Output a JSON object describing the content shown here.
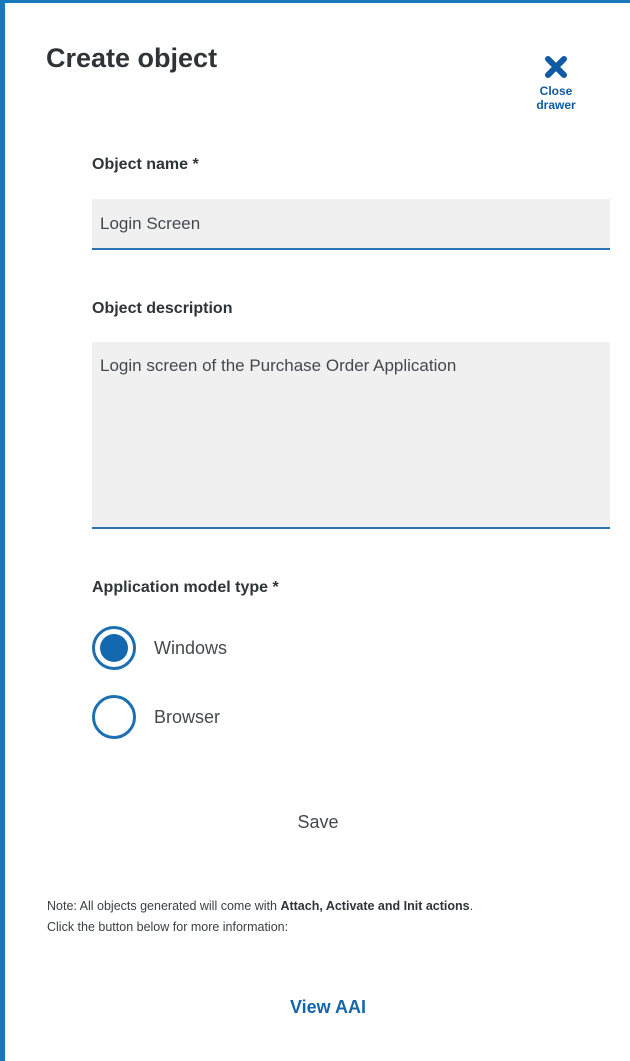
{
  "drawer": {
    "title": "Create object",
    "close_label_line1": "Close",
    "close_label_line2": "drawer"
  },
  "form": {
    "object_name_label": "Object name *",
    "object_name_value": "Login Screen",
    "object_description_label": "Object description",
    "object_description_value": "Login screen of the Purchase Order Application",
    "model_type_label": "Application model type *",
    "model_type_options": [
      {
        "label": "Windows",
        "selected": true
      },
      {
        "label": "Browser",
        "selected": false
      }
    ],
    "save_label": "Save"
  },
  "note": {
    "prefix": "Note: All objects generated will come with ",
    "bold": "Attach, Activate and Init actions",
    "suffix": ".",
    "line2": "Click the button below for more information:"
  },
  "link": {
    "view_aai_label": "View AAI"
  },
  "colors": {
    "accent": "#1c79b9",
    "radio_selected": "#1468b0",
    "input_background": "#f0f0f0"
  },
  "icons": {
    "close": "close-x-icon"
  }
}
